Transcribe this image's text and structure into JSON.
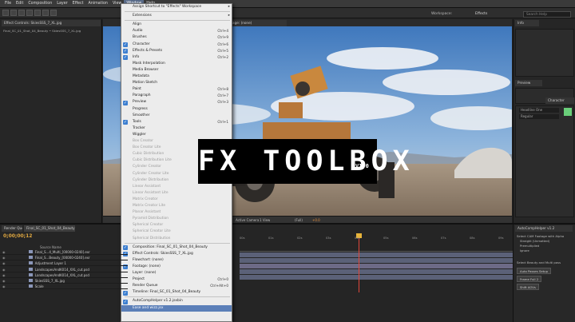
{
  "menubar": [
    "File",
    "Edit",
    "Composition",
    "Layer",
    "Effect",
    "Animation",
    "View",
    "Window",
    "Help"
  ],
  "menubar_active": "Window",
  "workspace": {
    "label": "Workspace:",
    "value": "Effects"
  },
  "search": {
    "placeholder": "Search Help"
  },
  "left_panel": {
    "tab": "Effect Controls: SkiesSSS_7_XL.jpg",
    "breadcrumb": "Final_SC_01_Shot_04_Beauty • SkiesSSS_7_XL.jpg"
  },
  "viewer": {
    "tab": "Footage: (none)",
    "bar": [
      "Active Camera",
      "1 View",
      "(Full)",
      "+0.0"
    ]
  },
  "right_panel": {
    "tab_info": "Info",
    "tab_preview": "Preview",
    "tab_character": "Character",
    "font": "Headline One",
    "style": "Regular"
  },
  "timeline": {
    "tab": "Final_SC_01_Shot_04_Beauty",
    "render_tab": "Render Queue",
    "timecode": "0;00;00;12",
    "col_header": "Source Name",
    "ruler": [
      "00s",
      "01s",
      "02s",
      "03s",
      "04s",
      "05s",
      "06s",
      "07s",
      "08s",
      "09s"
    ],
    "layers": [
      "Final_S...4_Multi_[00000-0240].exr",
      "Final_S...Beauty_[00000-0240].exr",
      "Adjustment Layer 1",
      "LandscapesAndK014_XXL_cut.psd",
      "LandscapesAndK014_XXL_cut.psd",
      "SkiesSSS_7_XL.jpg",
      "Scale"
    ]
  },
  "autocomp": {
    "tab": "AutoCompHelper v1.2",
    "label1": "Select CAM Footage with Alpha",
    "opts": [
      "Straight (Unmatted)",
      "Premultiplied",
      "Ignore"
    ],
    "label2": "Select Beauty and Multi pass",
    "buttons": [
      "Auto Passes Setup",
      "Frame Full 2",
      "Shift AOVs"
    ]
  },
  "menu": [
    {
      "label": "Assign Shortcut to \"Effects\" Workspace",
      "arrow": true
    },
    {
      "sep": true
    },
    {
      "label": "Extensions",
      "arrow": true
    },
    {
      "sep": true
    },
    {
      "label": "Align"
    },
    {
      "label": "Audio",
      "sc": "Ctrl+4"
    },
    {
      "label": "Brushes",
      "sc": "Ctrl+9"
    },
    {
      "label": "Character",
      "sc": "Ctrl+6",
      "check": true
    },
    {
      "label": "Effects & Presets",
      "sc": "Ctrl+5",
      "check": true
    },
    {
      "label": "Info",
      "sc": "Ctrl+2",
      "check": true
    },
    {
      "label": "Mask Interpolation"
    },
    {
      "label": "Media Browser"
    },
    {
      "label": "Metadata"
    },
    {
      "label": "Motion Sketch"
    },
    {
      "label": "Paint",
      "sc": "Ctrl+8"
    },
    {
      "label": "Paragraph",
      "sc": "Ctrl+7"
    },
    {
      "label": "Preview",
      "sc": "Ctrl+3",
      "check": true
    },
    {
      "label": "Progress"
    },
    {
      "label": "Smoother"
    },
    {
      "label": "Tools",
      "sc": "Ctrl+1",
      "check": true
    },
    {
      "label": "Tracker"
    },
    {
      "label": "Wiggler"
    },
    {
      "label": "Box Creator",
      "disabled": true
    },
    {
      "label": "Box Creator Lite",
      "disabled": true
    },
    {
      "label": "Cubic Distribution",
      "disabled": true
    },
    {
      "label": "Cubic Distribution Lite",
      "disabled": true
    },
    {
      "label": "Cylinder Creator",
      "disabled": true
    },
    {
      "label": "Cylinder Creator Lite",
      "disabled": true
    },
    {
      "label": "Cylinder Distribution",
      "disabled": true
    },
    {
      "label": "Linear Assistant",
      "disabled": true
    },
    {
      "label": "Linear Assistant Lite",
      "disabled": true
    },
    {
      "label": "Matrix Creator",
      "disabled": true
    },
    {
      "label": "Matrix Creator Lite",
      "disabled": true
    },
    {
      "label": "Planar Assistant",
      "disabled": true
    },
    {
      "label": "Pyramid Distribution",
      "disabled": true
    },
    {
      "label": "Spherical Creator",
      "disabled": true
    },
    {
      "label": "Spherical Creator Lite",
      "disabled": true
    },
    {
      "label": "Spherical Distribution",
      "disabled": true
    },
    {
      "sep": true
    },
    {
      "label": "Composition: Final_SC_01_Shot_04_Beauty",
      "check": true
    },
    {
      "label": "Effect Controls: SkiesSSS_7_XL.jpg",
      "check": true
    },
    {
      "label": "Flowchart: (none)"
    },
    {
      "label": "Footage: (none)",
      "check": true
    },
    {
      "label": "Layer: (none)"
    },
    {
      "label": "Project",
      "sc": "Ctrl+0"
    },
    {
      "label": "Render Queue",
      "sc": "Ctrl+Alt+0"
    },
    {
      "label": "Timeline: Final_SC_01_Shot_04_Beauty",
      "check": true
    },
    {
      "sep": true
    },
    {
      "label": "AutoCompHelper v1.2.jsxbin",
      "check": true
    },
    {
      "label": "Ease and wizz.jsx",
      "hl": true
    }
  ],
  "title_card": {
    "main": "FX TOOLBOX",
    "version": "V1.0"
  }
}
